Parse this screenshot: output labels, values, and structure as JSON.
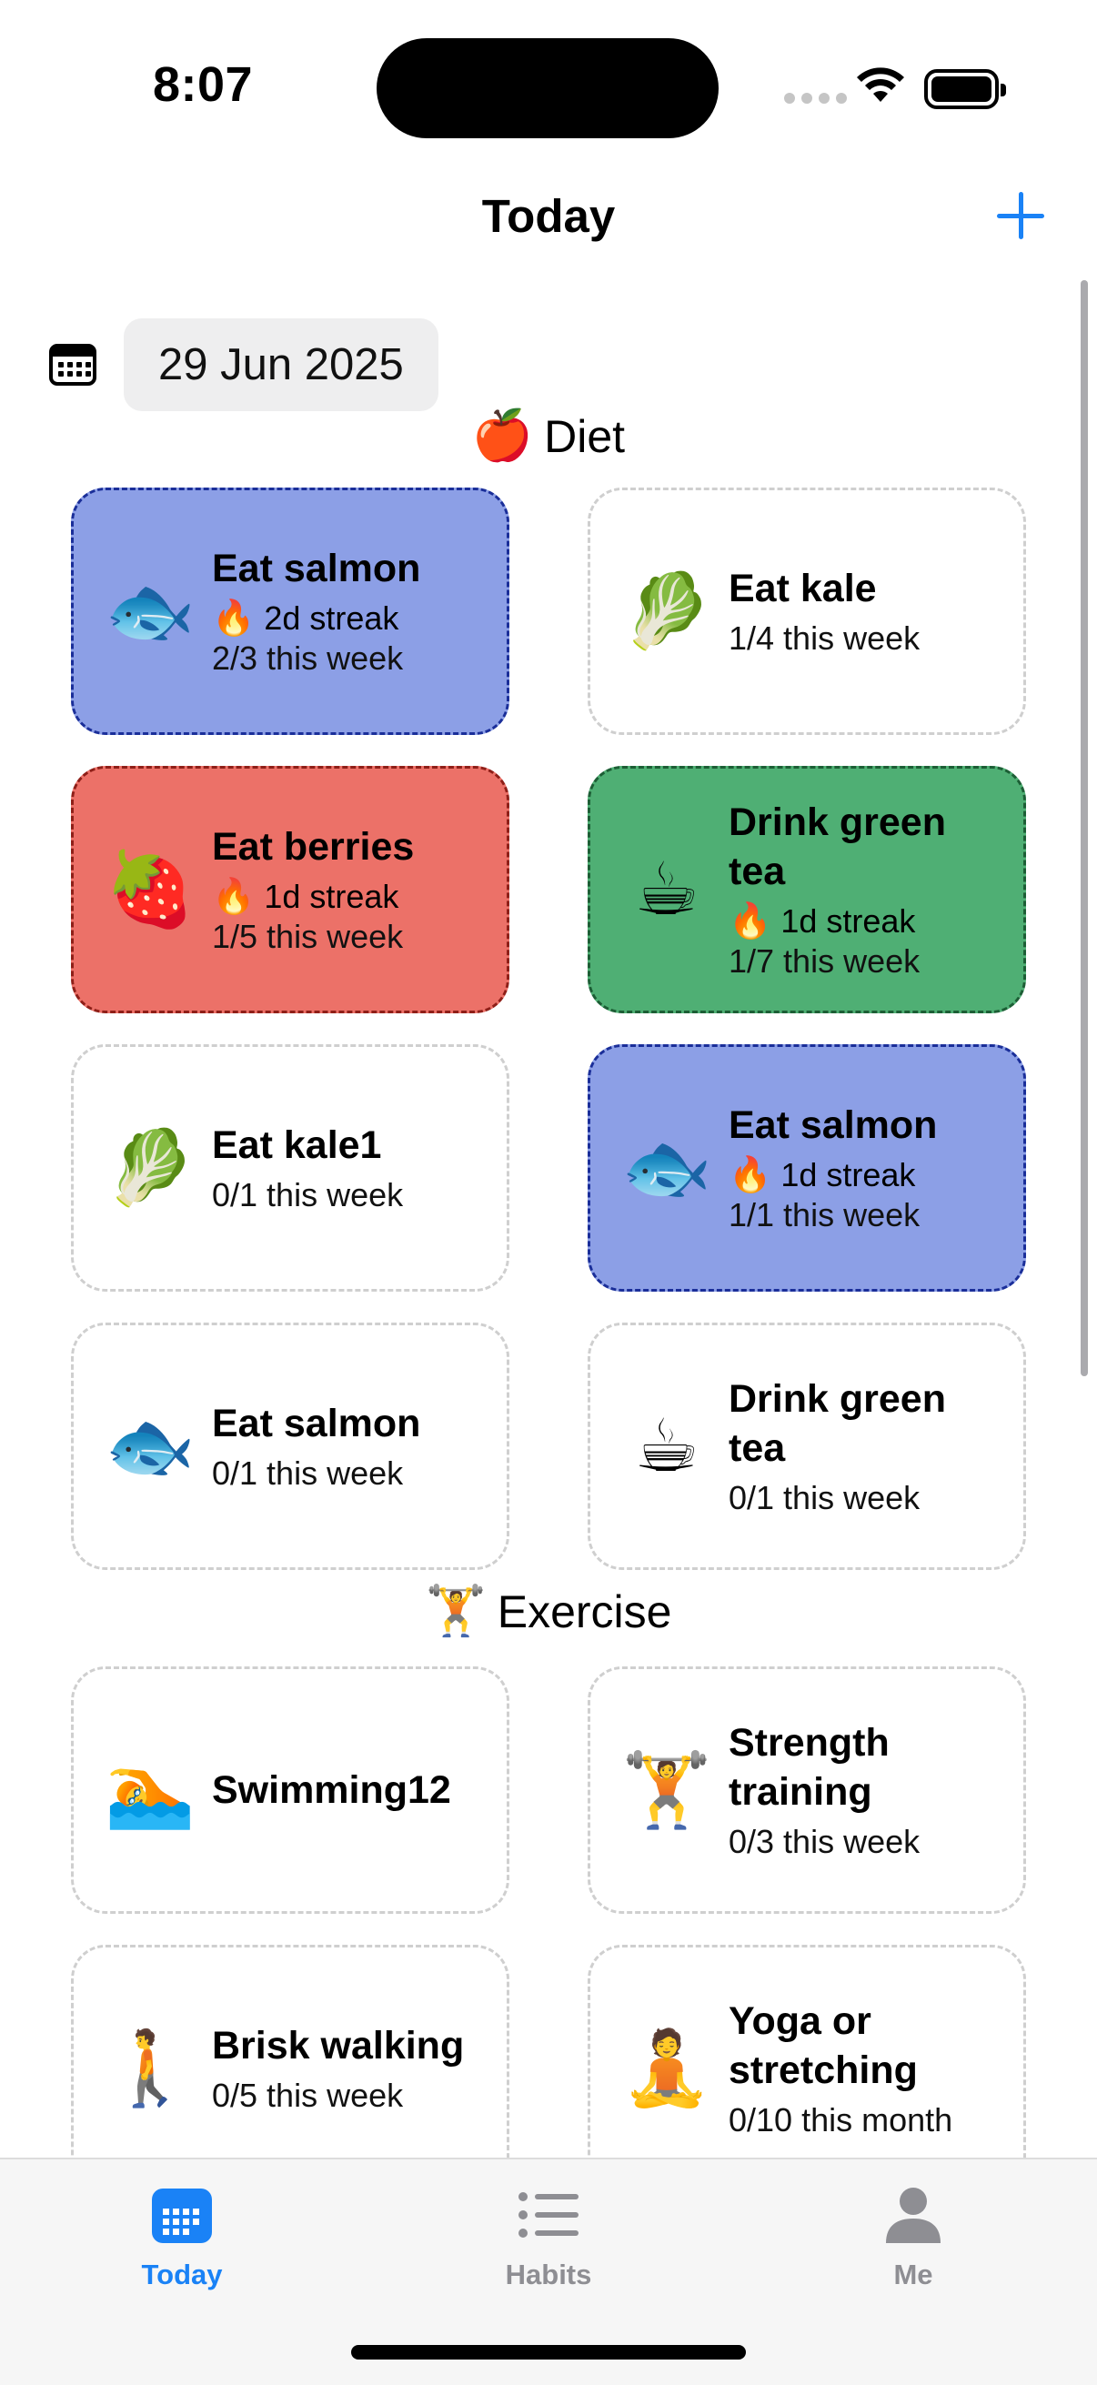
{
  "status_bar": {
    "time": "8:07"
  },
  "nav": {
    "title": "Today",
    "add_icon": "plus-icon"
  },
  "date": {
    "value": "29 Jun 2025",
    "icon": "calendar-icon"
  },
  "sections": [
    {
      "emoji": "🍎",
      "title": "Diet",
      "cards": [
        {
          "emoji": "🐟",
          "title": "Eat salmon",
          "streak": "2d streak",
          "progress": "2/3 this week",
          "color": "#8c9fe6"
        },
        {
          "emoji": "🥬",
          "title": "Eat kale",
          "streak": "",
          "progress": "1/4 this week",
          "color": ""
        },
        {
          "emoji": "🍓",
          "title": "Eat berries",
          "streak": "1d streak",
          "progress": "1/5 this week",
          "color": "#ec7168"
        },
        {
          "emoji": "☕",
          "title": "Drink green tea",
          "streak": "1d streak",
          "progress": "1/7 this week",
          "color": "#4faf74"
        },
        {
          "emoji": "🥬",
          "title": "Eat kale1",
          "streak": "",
          "progress": "0/1 this week",
          "color": ""
        },
        {
          "emoji": "🐟",
          "title": "Eat salmon",
          "streak": "1d streak",
          "progress": "1/1 this week",
          "color": "#8c9fe6"
        },
        {
          "emoji": "🐟",
          "title": "Eat salmon",
          "streak": "",
          "progress": "0/1 this week",
          "color": ""
        },
        {
          "emoji": "☕",
          "title": "Drink green tea",
          "streak": "",
          "progress": "0/1 this week",
          "color": ""
        }
      ]
    },
    {
      "emoji": "🏋️",
      "title": "Exercise",
      "cards": [
        {
          "emoji": "🏊",
          "title": "Swimming12",
          "streak": "",
          "progress": "",
          "color": ""
        },
        {
          "emoji": "🏋️",
          "title": "Strength training",
          "streak": "",
          "progress": "0/3 this week",
          "color": ""
        },
        {
          "emoji": "🚶",
          "title": "Brisk walking",
          "streak": "",
          "progress": "0/5 this week",
          "color": ""
        },
        {
          "emoji": "🧘",
          "title": "Yoga or stretching",
          "streak": "",
          "progress": "0/10 this month",
          "color": ""
        }
      ]
    }
  ],
  "streak_icon": "🔥",
  "tab_bar": {
    "tabs": [
      {
        "label": "Today",
        "icon": "calendar-icon",
        "active": true
      },
      {
        "label": "Habits",
        "icon": "list-icon",
        "active": false
      },
      {
        "label": "Me",
        "icon": "person-icon",
        "active": false
      }
    ]
  },
  "colors": {
    "accent": "#1a82f6",
    "blue_card": "#8c9fe6",
    "red_card": "#ec7168",
    "green_card": "#4faf74"
  }
}
